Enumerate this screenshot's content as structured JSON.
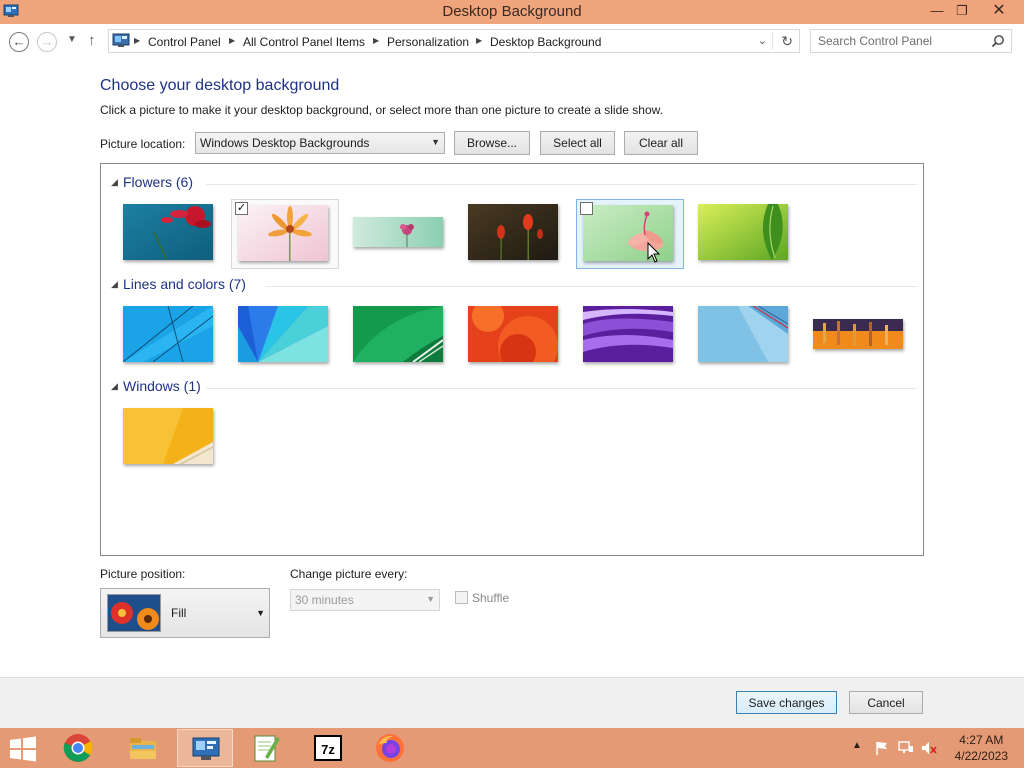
{
  "window": {
    "title": "Desktop Background"
  },
  "address_bar": {
    "breadcrumbs": [
      "Control Panel",
      "All Control Panel Items",
      "Personalization",
      "Desktop Background"
    ],
    "search_placeholder": "Search Control Panel"
  },
  "content": {
    "heading": "Choose your desktop background",
    "description": "Click a picture to make it your desktop background, or select more than one picture to create a slide show.",
    "picture_location_label": "Picture location:",
    "picture_location_value": "Windows Desktop Backgrounds",
    "browse_label": "Browse...",
    "select_all_label": "Select all",
    "clear_all_label": "Clear all"
  },
  "groups": [
    {
      "name": "Flowers (6)",
      "thumbs": [
        {
          "desc": "red-flower-teal"
        },
        {
          "desc": "orange-flower-pink",
          "checked": true
        },
        {
          "desc": "pink-flower-strip"
        },
        {
          "desc": "red-tulips-dark"
        },
        {
          "desc": "pink-flower-green",
          "checked": false,
          "hover": true
        },
        {
          "desc": "green-leaf"
        }
      ]
    },
    {
      "name": "Lines and colors (7)",
      "thumbs": [
        {
          "desc": "blue-lines"
        },
        {
          "desc": "blue-fan"
        },
        {
          "desc": "green-ribbon"
        },
        {
          "desc": "orange-swirl"
        },
        {
          "desc": "purple-waves"
        },
        {
          "desc": "light-blue-shapes"
        },
        {
          "desc": "orange-bars"
        }
      ]
    },
    {
      "name": "Windows (1)",
      "thumbs": [
        {
          "desc": "yellow-windows"
        }
      ]
    }
  ],
  "options": {
    "picture_position_label": "Picture position:",
    "picture_position_value": "Fill",
    "change_every_label": "Change picture every:",
    "change_every_value": "30 minutes",
    "shuffle_label": "Shuffle"
  },
  "footer": {
    "save_label": "Save changes",
    "cancel_label": "Cancel"
  },
  "taskbar": {
    "apps": [
      "chrome-icon",
      "file-explorer-icon",
      "control-panel-icon",
      "notepad-plus-plus-icon",
      "7zip-icon",
      "firefox-icon"
    ],
    "active_app": "control-panel-icon",
    "sevenzip_text": "7z",
    "time": "4:27 AM",
    "date": "4/22/2023"
  },
  "colors": {
    "titlebar": "#f0a47c",
    "taskbar": "#e49a74",
    "heading": "#1e3287"
  }
}
